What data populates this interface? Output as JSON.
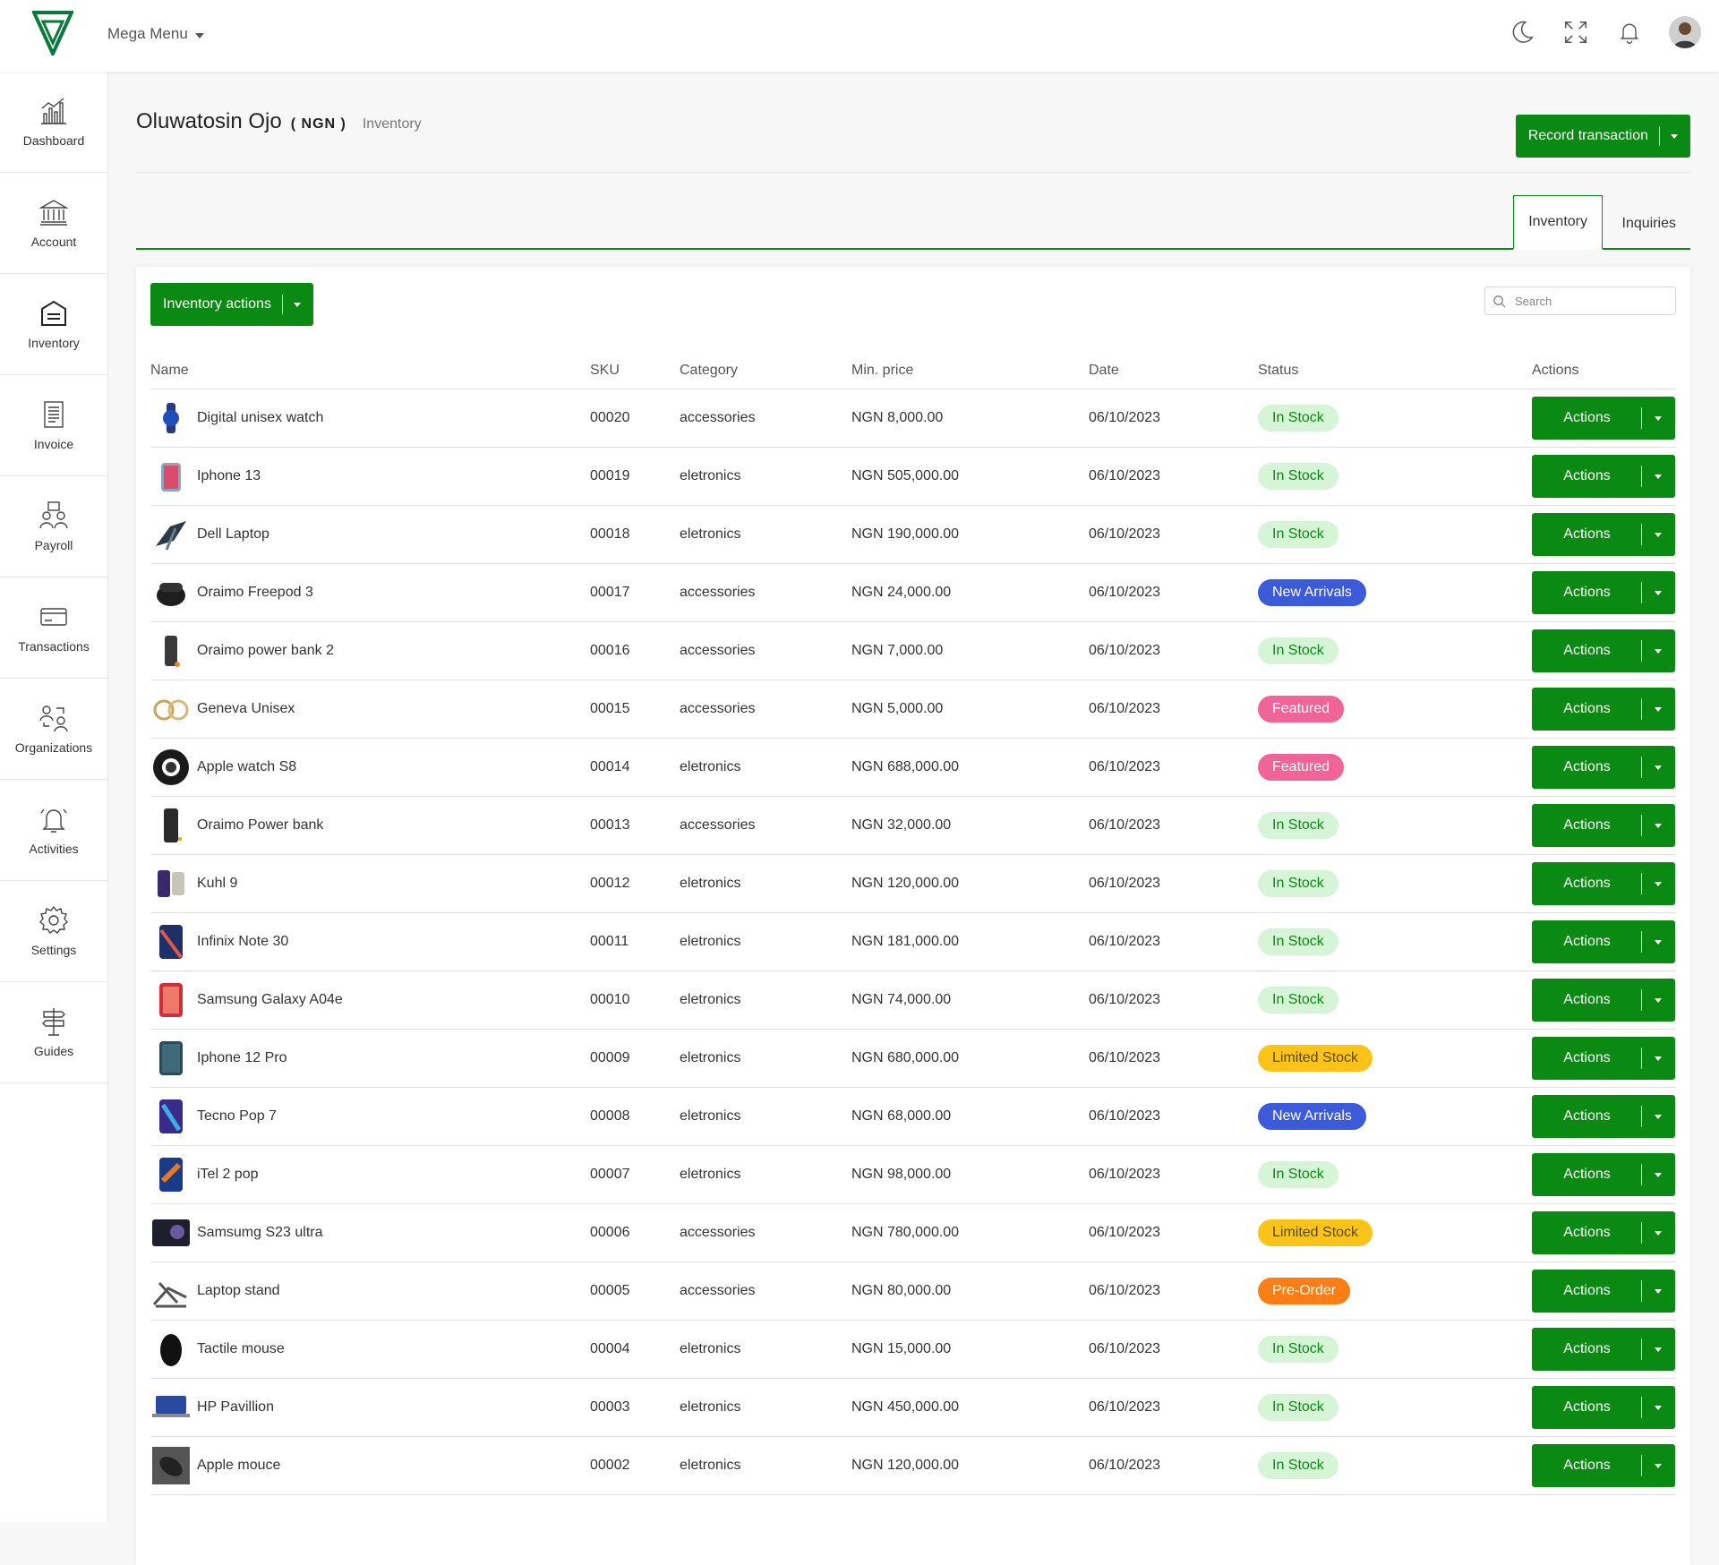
{
  "header": {
    "mega_menu": "Mega Menu",
    "colors": {
      "primary": "#0a8a12"
    }
  },
  "sidebar": {
    "items": [
      {
        "label": "Dashboard",
        "icon": "chart-icon"
      },
      {
        "label": "Account",
        "icon": "bank-icon"
      },
      {
        "label": "Inventory",
        "icon": "box-icon"
      },
      {
        "label": "Invoice",
        "icon": "document-icon"
      },
      {
        "label": "Payroll",
        "icon": "people-money-icon"
      },
      {
        "label": "Transactions",
        "icon": "card-icon"
      },
      {
        "label": "Organizations",
        "icon": "organization-icon"
      },
      {
        "label": "Activities",
        "icon": "bell-alert-icon"
      },
      {
        "label": "Settings",
        "icon": "gear-icon"
      },
      {
        "label": "Guides",
        "icon": "signpost-icon"
      }
    ]
  },
  "page": {
    "name": "Oluwatosin Ojo",
    "currency": "( NGN )",
    "breadcrumb": "Inventory",
    "record_button": "Record transaction"
  },
  "tabs": {
    "inventory": "Inventory",
    "inquiries": "Inquiries"
  },
  "toolbar": {
    "inventory_actions": "Inventory actions",
    "search_placeholder": "Search"
  },
  "table": {
    "headers": {
      "name": "Name",
      "sku": "SKU",
      "category": "Category",
      "price": "Min. price",
      "date": "Date",
      "status": "Status",
      "actions": "Actions"
    },
    "rows": [
      {
        "name": "Digital unisex watch",
        "sku": "00020",
        "category": "accessories",
        "price": "NGN 8,000.00",
        "date": "06/10/2023",
        "status": "In Stock",
        "action": "Actions"
      },
      {
        "name": "Iphone 13",
        "sku": "00019",
        "category": "eletronics",
        "price": "NGN 505,000.00",
        "date": "06/10/2023",
        "status": "In Stock",
        "action": "Actions"
      },
      {
        "name": "Dell Laptop",
        "sku": "00018",
        "category": "eletronics",
        "price": "NGN 190,000.00",
        "date": "06/10/2023",
        "status": "In Stock",
        "action": "Actions"
      },
      {
        "name": "Oraimo Freepod 3",
        "sku": "00017",
        "category": "accessories",
        "price": "NGN 24,000.00",
        "date": "06/10/2023",
        "status": "New Arrivals",
        "action": "Actions"
      },
      {
        "name": "Oraimo power bank 2",
        "sku": "00016",
        "category": "accessories",
        "price": "NGN 7,000.00",
        "date": "06/10/2023",
        "status": "In Stock",
        "action": "Actions"
      },
      {
        "name": "Geneva Unisex",
        "sku": "00015",
        "category": "accessories",
        "price": "NGN 5,000.00",
        "date": "06/10/2023",
        "status": "Featured",
        "action": "Actions"
      },
      {
        "name": "Apple watch S8",
        "sku": "00014",
        "category": "eletronics",
        "price": "NGN 688,000.00",
        "date": "06/10/2023",
        "status": "Featured",
        "action": "Actions"
      },
      {
        "name": "Oraimo Power bank",
        "sku": "00013",
        "category": "accessories",
        "price": "NGN 32,000.00",
        "date": "06/10/2023",
        "status": "In Stock",
        "action": "Actions"
      },
      {
        "name": "Kuhl 9",
        "sku": "00012",
        "category": "eletronics",
        "price": "NGN 120,000.00",
        "date": "06/10/2023",
        "status": "In Stock",
        "action": "Actions"
      },
      {
        "name": "Infinix Note 30",
        "sku": "00011",
        "category": "eletronics",
        "price": "NGN 181,000.00",
        "date": "06/10/2023",
        "status": "In Stock",
        "action": "Actions"
      },
      {
        "name": "Samsung Galaxy A04e",
        "sku": "00010",
        "category": "eletronics",
        "price": "NGN 74,000.00",
        "date": "06/10/2023",
        "status": "In Stock",
        "action": "Actions"
      },
      {
        "name": "Iphone 12 Pro",
        "sku": "00009",
        "category": "eletronics",
        "price": "NGN 680,000.00",
        "date": "06/10/2023",
        "status": "Limited Stock",
        "action": "Actions"
      },
      {
        "name": "Tecno Pop 7",
        "sku": "00008",
        "category": "eletronics",
        "price": "NGN 68,000.00",
        "date": "06/10/2023",
        "status": "New Arrivals",
        "action": "Actions"
      },
      {
        "name": "iTel 2 pop",
        "sku": "00007",
        "category": "eletronics",
        "price": "NGN 98,000.00",
        "date": "06/10/2023",
        "status": "In Stock",
        "action": "Actions"
      },
      {
        "name": "Samsumg S23 ultra",
        "sku": "00006",
        "category": "accessories",
        "price": "NGN 780,000.00",
        "date": "06/10/2023",
        "status": "Limited Stock",
        "action": "Actions"
      },
      {
        "name": "Laptop stand",
        "sku": "00005",
        "category": "accessories",
        "price": "NGN 80,000.00",
        "date": "06/10/2023",
        "status": "Pre-Order",
        "action": "Actions"
      },
      {
        "name": "Tactile mouse",
        "sku": "00004",
        "category": "eletronics",
        "price": "NGN 15,000.00",
        "date": "06/10/2023",
        "status": "In Stock",
        "action": "Actions"
      },
      {
        "name": "HP Pavillion",
        "sku": "00003",
        "category": "eletronics",
        "price": "NGN 450,000.00",
        "date": "06/10/2023",
        "status": "In Stock",
        "action": "Actions"
      },
      {
        "name": "Apple mouce",
        "sku": "00002",
        "category": "eletronics",
        "price": "NGN 120,000.00",
        "date": "06/10/2023",
        "status": "In Stock",
        "action": "Actions"
      }
    ]
  },
  "status_colors": {
    "In Stock": "b-in",
    "New Arrivals": "b-new",
    "Featured": "b-feat",
    "Limited Stock": "b-lim",
    "Pre-Order": "b-pre"
  }
}
